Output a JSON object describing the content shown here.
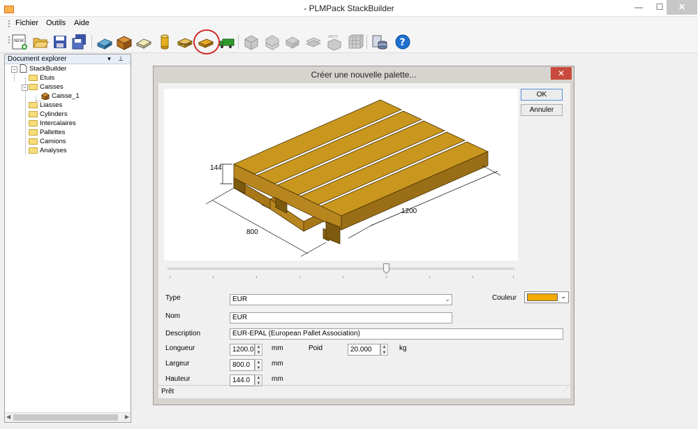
{
  "window": {
    "title": " - PLMPack StackBuilder",
    "icon": "stack-icon",
    "controls": {
      "minimize": "—",
      "maximize": "☐",
      "close": "✕"
    }
  },
  "menu": {
    "items": [
      "Fichier",
      "Outils",
      "Aide"
    ]
  },
  "toolbar": {
    "buttons": [
      "new-document-icon",
      "open-folder-icon",
      "save-icon",
      "save-all-icon",
      "new-box-icon",
      "new-case-icon",
      "new-bundle-icon",
      "new-cylinder-icon",
      "new-interlayer-icon",
      "new-pallet-icon",
      "new-truck-icon",
      "new-analysis-icon",
      "new-case-analysis-icon",
      "new-bundle-analysis-icon",
      "new-interlayer-analysis-icon",
      "new-truck-analysis-icon",
      "new-optimization-icon",
      "database-icon",
      "help-icon"
    ],
    "highlighted": "new-pallet-icon",
    "highlight_color": "#d02a2a"
  },
  "explorer": {
    "title": "Document explorer",
    "header_icons": "▾ ⊥",
    "root": "StackBuilder",
    "nodes": [
      "Etuis",
      "Caisses",
      "Caisse_1",
      "Liasses",
      "Cylinders",
      "Intercalaires",
      "Pallettes",
      "Camions",
      "Analyses"
    ]
  },
  "dialog": {
    "title": "Créer une nouvelle palette...",
    "close": "✕",
    "ok": "OK",
    "cancel": "Annuler",
    "preview": {
      "dim_height": "144",
      "dim_width": "800",
      "dim_length": "1200",
      "wood_color": "#c9961e"
    },
    "slider_value": 0.63,
    "labels": {
      "type": "Type",
      "name": "Nom",
      "description": "Description",
      "length": "Longueur",
      "width": "Largeur",
      "height": "Hauteur",
      "weight": "Poid",
      "color": "Couleur",
      "unit_mm": "mm",
      "unit_kg": "kg"
    },
    "values": {
      "type": "EUR",
      "name": "EUR",
      "description": "EUR-EPAL (European Pallet Association)",
      "length": "1200.0",
      "width": "800.0",
      "height": "144.0",
      "weight": "20.000",
      "color": "#f2a900"
    },
    "status": "Prêt"
  }
}
